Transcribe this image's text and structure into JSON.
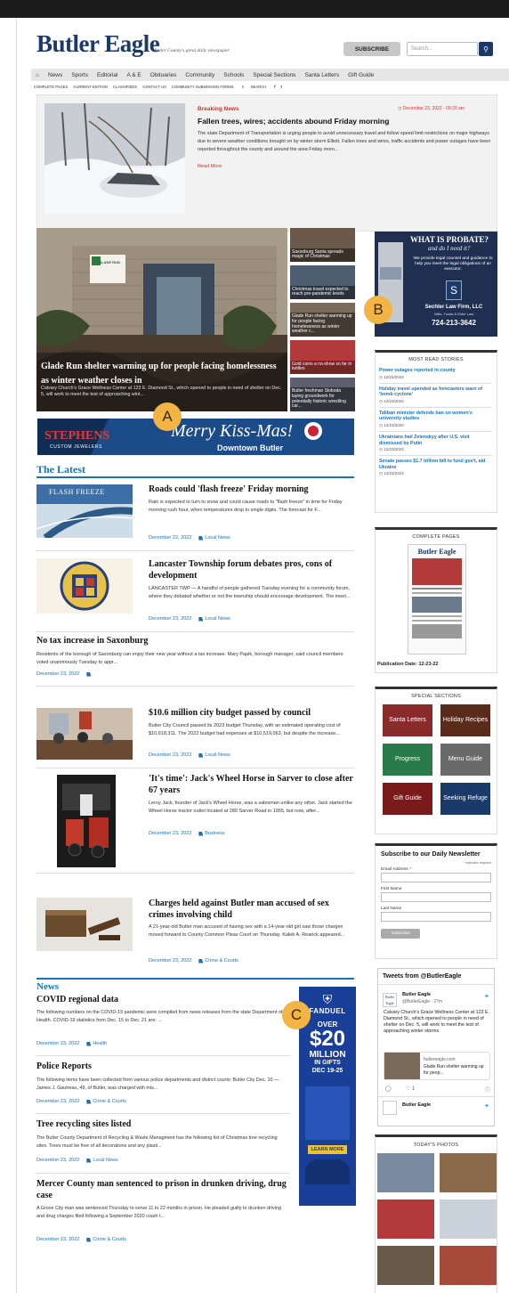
{
  "header": {
    "logo": "Butler Eagle",
    "tagline": "Butler County's great daily newspaper",
    "subscribe": "SUBSCRIBE",
    "search_placeholder": "Search..."
  },
  "nav": {
    "items": [
      "News",
      "Sports",
      "Editorial",
      "A & E",
      "Obituaries",
      "Community",
      "Schools",
      "Special Sections",
      "Santa Letters",
      "Gift Guide"
    ],
    "sub": [
      "COMPLETE PAGES",
      "CURRENT EDITION",
      "CLASSIFIEDS",
      "CONTACT US",
      "COMMUNITY SUBMISSION FORMS",
      "SEARCH",
      "f",
      "t"
    ]
  },
  "breaking": {
    "label": "Breaking News",
    "date": "December 23, 2022 - 09:20 am",
    "title": "Fallen trees, wires; accidents abound Friday morning",
    "body": "The state Department of Transportation is urging people to avoid unnecessary travel and follow speed limit restrictions on major highways due to severe weather conditions brought on by winter storm Elliott. Fallen trees and wires, traffic accidents and power outages have been reported throughout the county and around the area Friday morn...",
    "read_more": "Read More"
  },
  "hero": {
    "title": "Glade Run shelter warming up for people facing homelessness as winter weather closes in",
    "caption": "Calvary Church's Grace Wellness Center at 123 E. Diamond St., which opened to people in need of shelter on Dec. 5, will work to meet the test of approaching wint...",
    "sign": "GLADE RUN"
  },
  "side_thumbs": [
    "Saxonburg Santa spreads magic of Christmas",
    "Christmas travel expected to reach pre-pandemic levels",
    "Glade Run shelter warming up for people facing homelessness as winter weather c...",
    "Gold coins a no-show so far in kettles",
    "Butler freshman Slobodа laying groundwork for potentially historic wrestling car..."
  ],
  "banner_ad": {
    "brand": "STEPHENS",
    "brand_sub": "CUSTOM JEWELERS",
    "slogan": "Merry Kiss-Mas!",
    "location": "Downtown Butler"
  },
  "latest": {
    "heading": "The Latest",
    "stories": [
      {
        "title": "Roads could 'flash freeze' Friday morning",
        "body": "Rain is expected to turn to snow and could cause roads to \"flash freeze\" in time for Friday morning rush hour, when temperatures drop to single digits. The forecast for F...",
        "date": "December 22, 2022",
        "cat": "Local News",
        "img_text": "FLASH FREEZE"
      },
      {
        "title": "Lancaster Township forum debates pros, cons of development",
        "body": "LANCASTER TWP — A handful of people gathered Tuesday evening for a community forum, where they debated whether or not the township should encourage development. The meet...",
        "date": "December 23, 2022",
        "cat": "Local News"
      },
      {
        "title": "No tax increase in Saxonburg",
        "body": "Residents of the borough of Saxonburg can enjoy their new year without a tax increase. Mary Papik, borough manager, said council members voted unanimously Tuesday to appr...",
        "date": "December 23, 2022",
        "cat": ""
      },
      {
        "title": "$10.6 million city budget passed by council",
        "body": "Butler City Council passed its 2023 budget Thursday, with an estimated operating cost of $10,618,311. The 2022 budget had expenses at $10,519,063, but despite the increase...",
        "date": "December 23, 2022",
        "cat": "Local News"
      },
      {
        "title": "'It's time': Jack's Wheel Horse in Sarver to close after 67 years",
        "body": "Leroy Jack, founder of Jack's Wheel Horse, was a salesman unlike any other. Jack started the Wheel Horse tractor outlet located at 280 Sarver Road in 1955, but now, after...",
        "date": "December 23, 2022",
        "cat": "Business"
      },
      {
        "title": "Charges held against Butler man accused of sex crimes involving child",
        "body": "A 21-year-old Butler man accused of having sex with a 14-year-old girl saw those charges moved forward to County Common Pleas Court on Thursday. Kaleb A. Rearick appeared...",
        "date": "December 23, 2022",
        "cat": "Crime & Courts"
      }
    ]
  },
  "news": {
    "heading": "News",
    "stories": [
      {
        "title": "COVID regional data",
        "body": "The following numbers on the COVID-19 pandemic were compiled from news releases from the state Department of Health. COVID-19 statistics from Dec. 15 to Dec. 21 are: ...",
        "date": "December 23, 2022",
        "cat": "Health"
      },
      {
        "title": "Police Reports",
        "body": "The following items have been collected from various police departments and district courts: Butler City Dec. 10 — James J. Gautreau, 49, of Butler, was charged with mis...",
        "date": "December 23, 2022",
        "cat": "Crime & Courts"
      },
      {
        "title": "Tree recycling sites listed",
        "body": "The Butler County Department of Recycling & Waste Managment has the following list of Christmas tree recycling sites. Trees must be free of all decorations and any plasti...",
        "date": "December 23, 2022",
        "cat": "Local News"
      },
      {
        "title": "Mercer County man sentenced to prison in drunken driving, drug case",
        "body": "A Grove City man was sentenced Thursday to serve 11 to 22 months in prison. He pleaded guilty to drunken driving and drug charges filed following a September 2020 crash t...",
        "date": "December 23, 2022",
        "cat": "Crime & Courts"
      }
    ]
  },
  "fanduel_ad": {
    "brand": "FANDUEL",
    "over": "OVER",
    "amount": "$20",
    "million": "MILLION",
    "gifts": "IN GIFTS",
    "dates": "DEC 19-25",
    "cta": "LEARN MORE"
  },
  "probate_ad": {
    "title": "WHAT IS PROBATE?",
    "sub": "and do I need it?",
    "body": "We provide legal counsel and guidance to help you meet the legal obligations of an executor.",
    "firm": "Sechler Law Firm, LLC",
    "firm_sub": "Wills, Trusts & Elder Law",
    "phone": "724-213-3642"
  },
  "most_read": {
    "title": "MOST READ STORIES",
    "items": [
      {
        "title": "Power outages reported in county",
        "date": "12/23/2022"
      },
      {
        "title": "Holiday travel upended as forecasters warn of 'bomb cyclone'",
        "date": "12/23/2022"
      },
      {
        "title": "Taliban minister defends ban on women's university studies",
        "date": "12/23/2022"
      },
      {
        "title": "Ukrainians hail Zelenskyy after U.S. visit dismissed by Putin",
        "date": "12/23/2022"
      },
      {
        "title": "Senate passes $1.7 trillion bill to fund gov't, aid Ukraine",
        "date": "12/23/2022"
      }
    ]
  },
  "complete_pages": {
    "title": "COMPLETE PAGES",
    "mini_logo": "Butler Eagle",
    "pub_date": "Publication Date: 12-23-22"
  },
  "special_sections": {
    "title": "SPECIAL SECTIONS",
    "items": [
      "Santa Letters",
      "Holiday Recipes",
      "Progress",
      "Menu Guide",
      "Gift Guide",
      "Seeking Refuge"
    ]
  },
  "newsletter": {
    "title": "Subscribe to our Daily Newsletter",
    "required_note": "* indicates required",
    "email_label": "Email Address",
    "first_label": "First Name",
    "last_label": "Last Name",
    "button": "Subscribe"
  },
  "tweets": {
    "title": "Tweets from @ButlerEagle",
    "name": "Butler Eagle",
    "handle": "@ButlerEagle · 27m",
    "text": "Calvary Church's Grace Wellness Center at 123 E. Diamond St., which opened to people in need of shelter on Dec. 5, will work to meet the test of approaching winter storms.",
    "link_site": "butlereagle.com",
    "link_title": "Glade Run shelter warming up for peop...",
    "reply_count": "",
    "like_count": "1",
    "next_name": "Butler Eagle"
  },
  "photos": {
    "title": "TODAY'S PHOTOS"
  },
  "markers": {
    "a": "A",
    "b": "B",
    "c": "C"
  }
}
